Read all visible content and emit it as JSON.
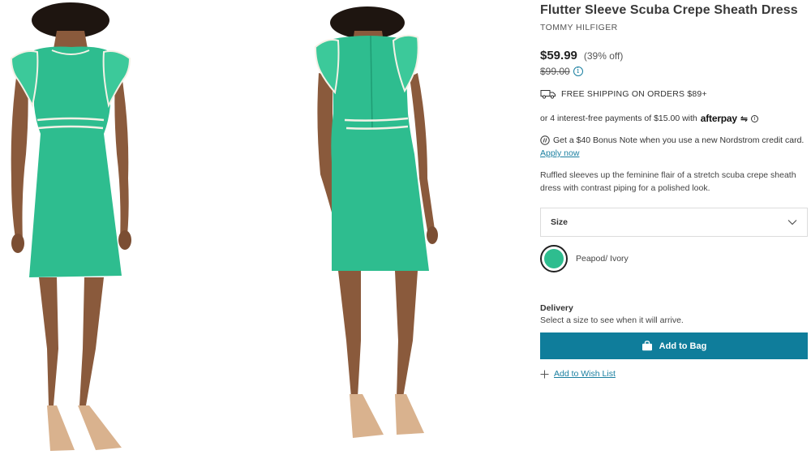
{
  "product": {
    "title": "Flutter Sleeve Scuba Crepe Sheath Dress",
    "brand": "TOMMY HILFIGER",
    "price": "$59.99",
    "discount": "(39% off)",
    "original_price": "$99.00",
    "shipping": "FREE SHIPPING ON ORDERS $89+",
    "installments": "or 4 interest-free payments of $15.00 with",
    "afterpay": "afterpay",
    "bonus_note": "Get a $40 Bonus Note when you use a new Nordstrom credit card.",
    "apply_now": "Apply now",
    "description": "Ruffled sleeves up the feminine flair of a stretch scuba crepe sheath dress with contrast piping for a polished look."
  },
  "size": {
    "label": "Size"
  },
  "color": {
    "name": "Peapod/ Ivory",
    "swatch_hex": "#2ebd8f"
  },
  "delivery": {
    "title": "Delivery",
    "subtitle": "Select a size to see when it will arrive."
  },
  "actions": {
    "add_to_bag": "Add to Bag",
    "add_to_wishlist": "Add to Wish List"
  },
  "theme": {
    "accent": "#0f7d9b",
    "dress": "#2ebd8f",
    "link": "#1a7fa0"
  }
}
